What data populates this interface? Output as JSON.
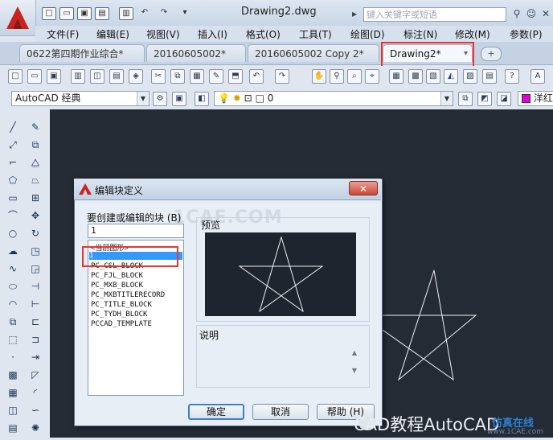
{
  "window": {
    "title": "Drawing2.dwg",
    "search_placeholder": "键入关键字或短语"
  },
  "menu": [
    "文件(F)",
    "编辑(E)",
    "视图(V)",
    "插入(I)",
    "格式(O)",
    "工具(T)",
    "绘图(D)",
    "标注(N)",
    "修改(M)",
    "参数(P)"
  ],
  "tabs": [
    {
      "label": "0622第四期作业综合*"
    },
    {
      "label": "20160605002*"
    },
    {
      "label": "20160605002 Copy 2*"
    },
    {
      "label": "Drawing2*"
    }
  ],
  "toolbar": {
    "workspace": "AutoCAD 经典",
    "layer_value": "0",
    "color_label": "洋红"
  },
  "dialog": {
    "title": "编辑块定义",
    "block_prompt": "要创建或编辑的块 (B)",
    "block_name": "1",
    "list_items": [
      "<当前图形>",
      "1",
      "PC_CSL_BLOCK",
      "PC_FJL_BLOCK",
      "PC_MXB_BLOCK",
      "PC_MXBTITLERECORD",
      "PC_TITLE_BLOCK",
      "PC_TYDH_BLOCK",
      "PCCAD_TEMPLATE"
    ],
    "selected_item": "1",
    "preview_label": "预览",
    "description_label": "说明",
    "ok_label": "确定",
    "cancel_label": "取消",
    "help_label": "帮助 (H)"
  },
  "watermarks": {
    "center": "1CAE.COM",
    "footer": "CAD教程AutoCAD",
    "corner": "仿真在线",
    "corner_url": "www.1CAE.com"
  },
  "colors": {
    "canvas": "#252b35",
    "highlight_red": "#ee3333",
    "selection_blue": "#3399ff",
    "acad_red": "#c9221f"
  }
}
